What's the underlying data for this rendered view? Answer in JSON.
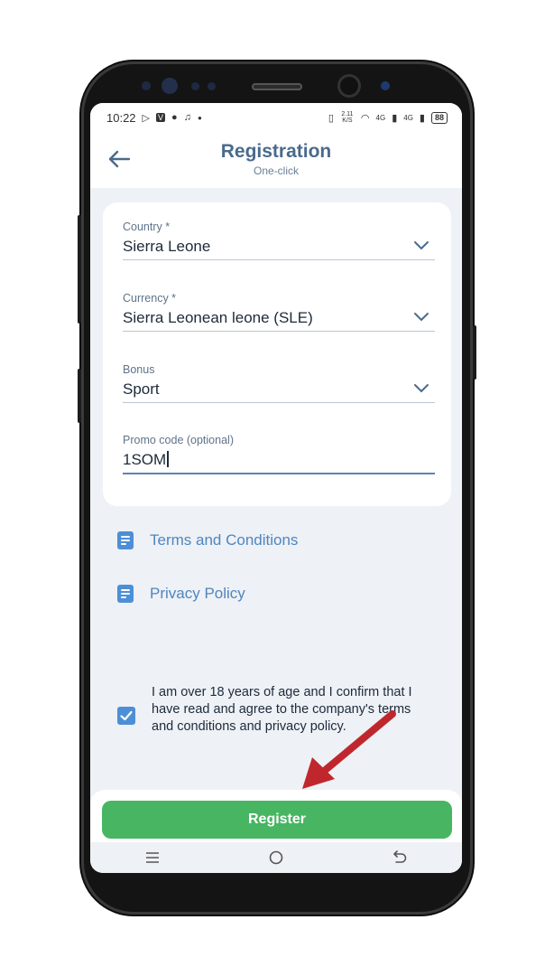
{
  "status_bar": {
    "time": "10:22",
    "net_speed": "2.11 K/S",
    "signal_1": "4G",
    "signal_2": "4G",
    "battery": "88"
  },
  "header": {
    "title": "Registration",
    "subtitle": "One-click"
  },
  "form": {
    "country": {
      "label": "Country *",
      "value": "Sierra Leone"
    },
    "currency": {
      "label": "Currency *",
      "value": "Sierra Leonean leone (SLE)"
    },
    "bonus": {
      "label": "Bonus",
      "value": "Sport"
    },
    "promo": {
      "label": "Promo code (optional)",
      "value": "1SOM"
    }
  },
  "links": {
    "terms": "Terms and Conditions",
    "privacy": "Privacy Policy"
  },
  "consent": {
    "checked": true,
    "text": "I am over 18 years of age and I confirm that I have read and agree to the company's terms and conditions and privacy policy."
  },
  "register_button": {
    "label": "Register"
  },
  "colors": {
    "accent": "#4d8fd6",
    "register": "#48b562",
    "annotation_arrow": "#c0272d"
  }
}
